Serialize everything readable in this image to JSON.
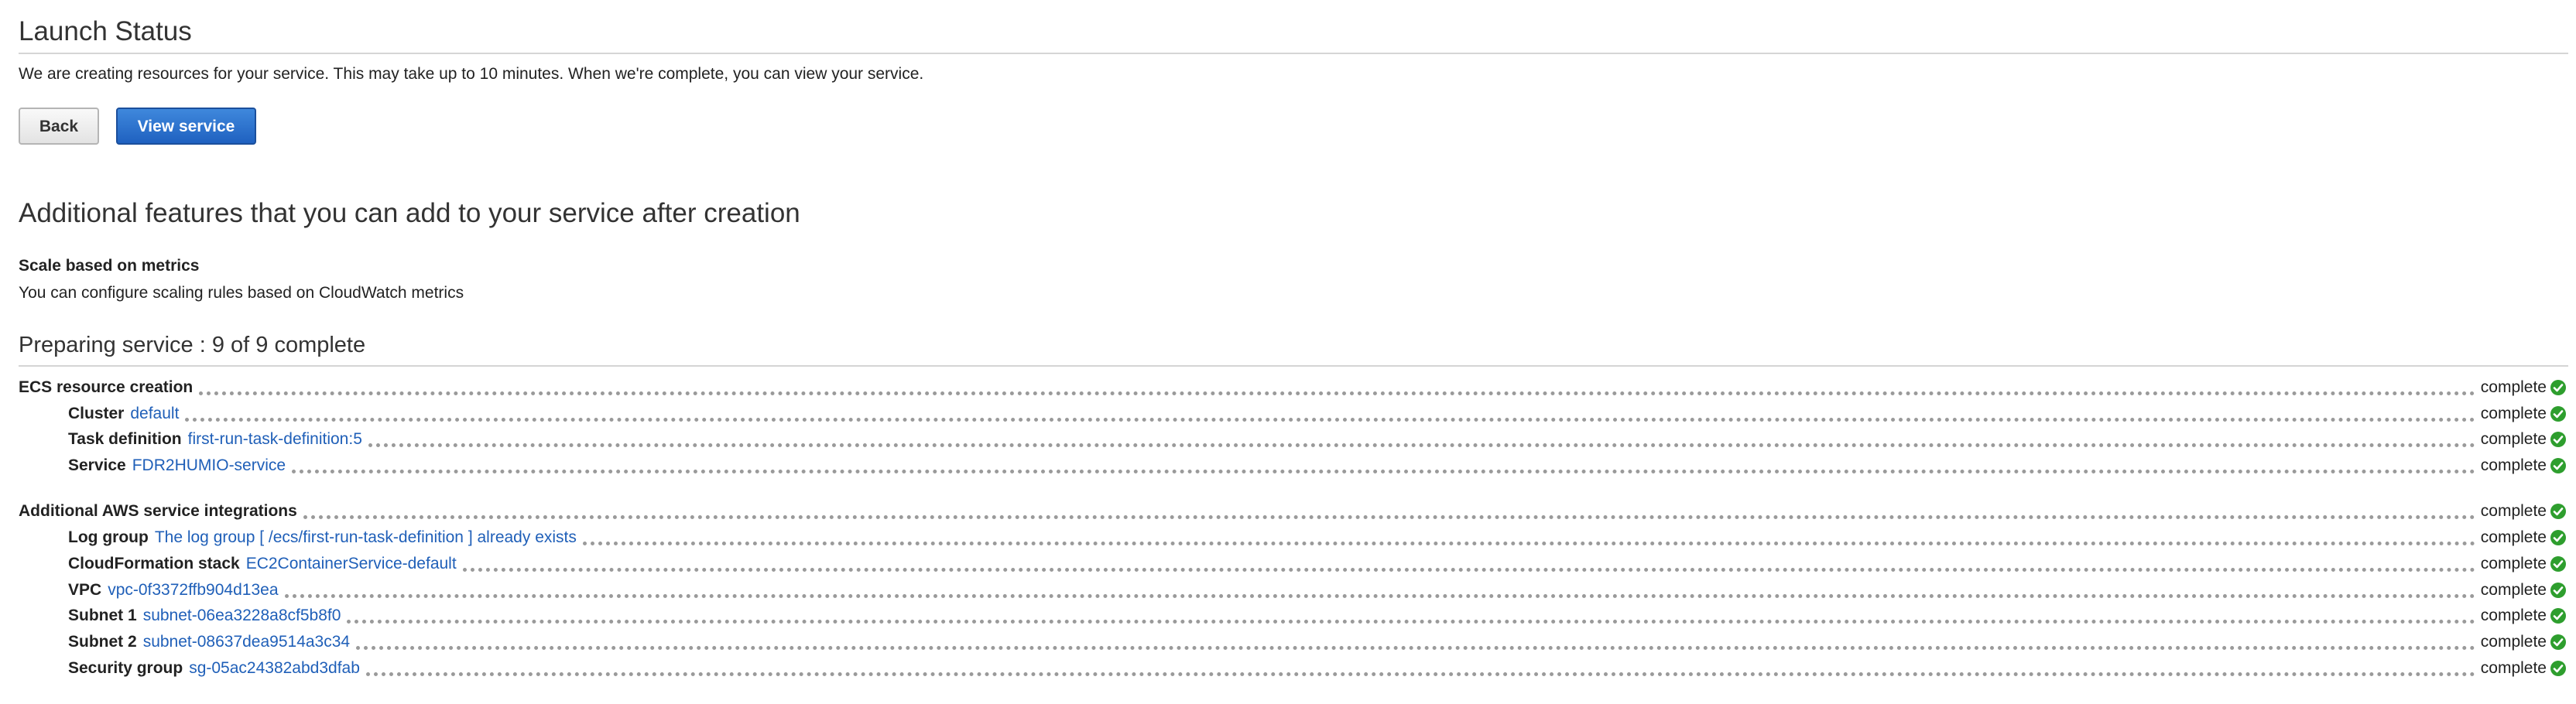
{
  "header": {
    "title": "Launch Status",
    "intro": "We are creating resources for your service. This may take up to 10 minutes. When we're complete, you can view your service."
  },
  "actions": {
    "back_label": "Back",
    "view_service_label": "View service"
  },
  "features": {
    "heading": "Additional features that you can add to your service after creation",
    "items": [
      {
        "title": "Scale based on metrics",
        "description": "You can configure scaling rules based on CloudWatch metrics"
      }
    ]
  },
  "progress": {
    "heading": "Preparing service : 9 of 9 complete",
    "status_icon": "check-circle-icon",
    "status_color": "#2e9e2e",
    "link_color": "#1f5fb8",
    "groups": [
      {
        "label": "ECS resource creation",
        "status": "complete",
        "items": [
          {
            "label": "Cluster",
            "value": "default",
            "status": "complete"
          },
          {
            "label": "Task definition",
            "value": "first-run-task-definition:5",
            "status": "complete"
          },
          {
            "label": "Service",
            "value": "FDR2HUMIO-service",
            "status": "complete"
          }
        ]
      },
      {
        "label": "Additional AWS service integrations",
        "status": "complete",
        "items": [
          {
            "label": "Log group",
            "value": "The log group [ /ecs/first-run-task-definition ] already exists",
            "status": "complete"
          },
          {
            "label": "CloudFormation stack",
            "value": "EC2ContainerService-default",
            "status": "complete"
          },
          {
            "label": "VPC",
            "value": "vpc-0f3372ffb904d13ea",
            "status": "complete"
          },
          {
            "label": "Subnet 1",
            "value": "subnet-06ea3228a8cf5b8f0",
            "status": "complete"
          },
          {
            "label": "Subnet 2",
            "value": "subnet-08637dea9514a3c34",
            "status": "complete"
          },
          {
            "label": "Security group",
            "value": "sg-05ac24382abd3dfab",
            "status": "complete"
          }
        ]
      }
    ]
  }
}
